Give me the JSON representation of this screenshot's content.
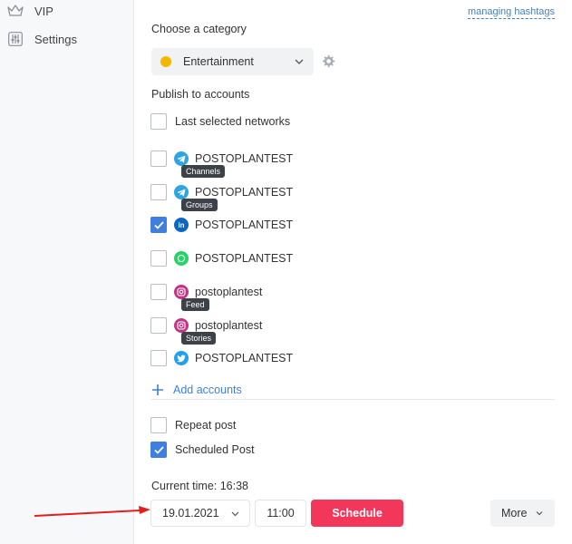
{
  "sidebar": {
    "items": [
      {
        "label": "VIP",
        "icon": "crown-icon"
      },
      {
        "label": "Settings",
        "icon": "sliders-icon"
      }
    ]
  },
  "header": {
    "hashtags_link": "managing hashtags"
  },
  "category": {
    "title": "Choose a category",
    "selected": "Entertainment",
    "color": "#f5b800"
  },
  "publish": {
    "title": "Publish to accounts",
    "last_selected_label": "Last selected networks",
    "accounts": [
      {
        "network": "telegram",
        "name": "POSTOPLANTEST",
        "tag": "Channels",
        "checked": false,
        "icon": "telegram-icon",
        "color": "#2ca5e0"
      },
      {
        "network": "telegram",
        "name": "POSTOPLANTEST",
        "tag": "Groups",
        "checked": false,
        "icon": "telegram-icon",
        "color": "#2ca5e0"
      },
      {
        "network": "linkedin",
        "name": "POSTOPLANTEST",
        "tag": "",
        "checked": true,
        "icon": "linkedin-icon",
        "color": "#0a66c2"
      },
      {
        "network": "whatsapp",
        "name": "POSTOPLANTEST",
        "tag": "",
        "checked": false,
        "icon": "whatsapp-icon",
        "color": "#25d366"
      },
      {
        "network": "instagram",
        "name": "postoplantest",
        "tag": "Feed",
        "checked": false,
        "icon": "instagram-icon",
        "color": "#c13584"
      },
      {
        "network": "instagram",
        "name": "postoplantest",
        "tag": "Stories",
        "checked": false,
        "icon": "instagram-icon",
        "color": "#c13584"
      },
      {
        "network": "twitter",
        "name": "POSTOPLANTEST",
        "tag": "",
        "checked": false,
        "icon": "twitter-icon",
        "color": "#1da1f2"
      }
    ],
    "add_accounts_label": "Add accounts"
  },
  "options": {
    "repeat_post_label": "Repeat post",
    "repeat_post_checked": false,
    "scheduled_post_label": "Scheduled Post",
    "scheduled_post_checked": true
  },
  "schedule": {
    "current_time_label": "Current time: 16:38",
    "date": "19.01.2021",
    "time": "11:00",
    "schedule_button": "Schedule",
    "more_button": "More"
  },
  "colors": {
    "accent": "#3e7fe0",
    "schedule_button": "#f2375b",
    "annotation_arrow": "#e0201c"
  }
}
